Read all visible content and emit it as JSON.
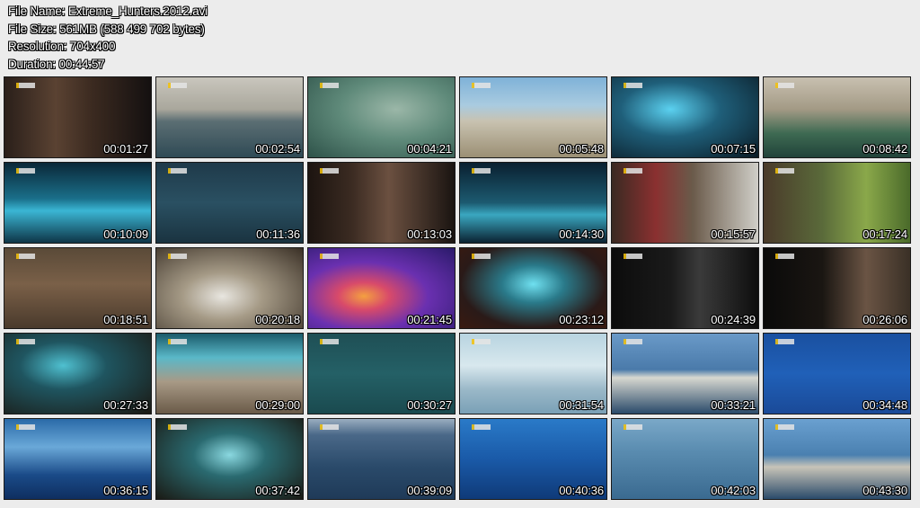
{
  "file_info": {
    "file_name": "File Name: Extreme_Hunters.2012.avi",
    "file_size": "File Size: 561MB (588 499 702 bytes)",
    "resolution": "Resolution: 704x400",
    "duration": "Duration: 00:44:57"
  },
  "thumbnails": [
    {
      "time": "00:01:27",
      "scene": "portrait-man-dark-room",
      "bg": "linear-gradient(90deg,#2a1f1a 0%,#5a4232 35%,#3b2a20 60%,#141010 100%)"
    },
    {
      "time": "00:02:54",
      "scene": "ocean-cloudy-sky",
      "bg": "linear-gradient(180deg,#c9c6bd 0%,#a9a79c 40%,#5b6e73 55%,#2f4a55 100%)"
    },
    {
      "time": "00:04:21",
      "scene": "underwater-green-bubbles",
      "bg": "radial-gradient(ellipse at 60% 40%,#9bb7a8 0%,#5f8a7a 45%,#2e5249 100%)"
    },
    {
      "time": "00:05:48",
      "scene": "tropical-pool-people",
      "bg": "linear-gradient(180deg,#7fb2d8 0%,#a9cbe0 35%,#c8c2b0 55%,#9b8f74 100%)"
    },
    {
      "time": "00:07:15",
      "scene": "hologram-man-blue",
      "bg": "radial-gradient(ellipse at 40% 40%,#5bd1f0 0%,#1f5f7a 40%,#0a1a24 100%)"
    },
    {
      "time": "00:08:42",
      "scene": "man-hat-fishing",
      "bg": "linear-gradient(180deg,#c8c0b0 0%,#a39a85 40%,#3e6a52 70%,#21433a 100%)"
    },
    {
      "time": "00:10:09",
      "scene": "hologram-blue-grid",
      "bg": "linear-gradient(180deg,#0b2838 0%,#1a6f8a 45%,#3bb6d4 60%,#0e3547 100%)"
    },
    {
      "time": "00:11:36",
      "scene": "deep-blue-water",
      "bg": "linear-gradient(180deg,#1f3a4a 0%,#2a5062 50%,#1a3340 100%)"
    },
    {
      "time": "00:13:03",
      "scene": "portrait-man-dark-room",
      "bg": "linear-gradient(90deg,#1c1410 0%,#3b2b22 30%,#6b5040 55%,#1a1411 100%)"
    },
    {
      "time": "00:14:30",
      "scene": "hologram-whale-grid",
      "bg": "linear-gradient(180deg,#0a2030 0%,#1c5a70 50%,#3aa7c0 65%,#0b2231 100%)"
    },
    {
      "time": "00:15:57",
      "scene": "workbench-red-toolbox",
      "bg": "linear-gradient(90deg,#3a2a22 0%,#8a3030 30%,#6a5a4a 55%,#d0cfc8 100%)"
    },
    {
      "time": "00:17:24",
      "scene": "man-forest-green",
      "bg": "linear-gradient(90deg,#4a3a2a 0%,#5a6a3a 40%,#8aa84a 70%,#4a6a2a 100%)"
    },
    {
      "time": "00:18:51",
      "scene": "tree-roots-forest",
      "bg": "linear-gradient(180deg,#5a4a38 0%,#7a6048 45%,#4a3a2c 100%)"
    },
    {
      "time": "00:20:18",
      "scene": "white-mug-closeup",
      "bg": "radial-gradient(ellipse at 45% 60%,#e8e6e0 0%,#a59a86 35%,#3a3026 100%)"
    },
    {
      "time": "00:21:45",
      "scene": "thermal-camera",
      "bg": "radial-gradient(ellipse at 38% 60%,#f4a040 0%,#d84a6a 20%,#6a30b0 50%,#2a1a6a 100%)"
    },
    {
      "time": "00:23:12",
      "scene": "hologram-head-platform",
      "bg": "radial-gradient(ellipse at 50% 45%,#6fe0f0 0%,#2a7a8a 30%,#2a1a18 70%,#3a1a10 100%)"
    },
    {
      "time": "00:24:39",
      "scene": "night-vision-room",
      "bg": "linear-gradient(90deg,#0c0c0c 0%,#1a1a1a 40%,#3a3a3a 60%,#0e0e0e 100%)"
    },
    {
      "time": "00:26:06",
      "scene": "man-closeup-dark",
      "bg": "linear-gradient(90deg,#0a0a0a 0%,#1a1612 40%,#6a5444 70%,#3a3026 100%)"
    },
    {
      "time": "00:27:33",
      "scene": "hologram-stage-people",
      "bg": "radial-gradient(ellipse at 40% 40%,#4fc0d0 0%,#1f5560 35%,#1a1812 100%)"
    },
    {
      "time": "00:29:00",
      "scene": "hologram-room-wide",
      "bg": "linear-gradient(180deg,#1a5a6a 0%,#5ab8c8 30%,#a89a86 60%,#6a5a48 100%)"
    },
    {
      "time": "00:30:27",
      "scene": "underwater-whale-dark",
      "bg": "linear-gradient(180deg,#1f4f55 0%,#246066 50%,#1a4a4f 100%)"
    },
    {
      "time": "00:31:54",
      "scene": "waves-foam-light",
      "bg": "linear-gradient(180deg,#b8d4e0 0%,#d8e8ee 40%,#9ab8c8 70%,#7aa0b6 100%)"
    },
    {
      "time": "00:33:21",
      "scene": "man-boat-jacket",
      "bg": "linear-gradient(180deg,#6a9ac8 0%,#4a7aaa 45%,#d8d8d0 55%,#2a4a6a 100%)"
    },
    {
      "time": "00:34:48",
      "scene": "open-blue-water",
      "bg": "linear-gradient(180deg,#1a50a0 0%,#2060b8 50%,#1a4a98 100%)"
    },
    {
      "time": "00:36:15",
      "scene": "underwater-surface-splash",
      "bg": "linear-gradient(180deg,#2a6aa8 0%,#6aa8d8 35%,#1a4a88 70%,#0f2f60 100%)"
    },
    {
      "time": "00:37:42",
      "scene": "hologram-whale-stage",
      "bg": "radial-gradient(ellipse at 50% 45%,#8ad8e0 0%,#2a6a70 35%,#1a1a14 100%)"
    },
    {
      "time": "00:39:09",
      "scene": "ocean-whale-surface",
      "bg": "linear-gradient(180deg,#9aaec0 0%,#4a6888 20%,#2a4a6a 60%,#1f3a58 100%)"
    },
    {
      "time": "00:40:36",
      "scene": "underwater-sperm-whale",
      "bg": "linear-gradient(180deg,#2a7ac8 0%,#1a5aa8 50%,#0f3a78 100%)"
    },
    {
      "time": "00:42:03",
      "scene": "ocean-surface-light",
      "bg": "linear-gradient(180deg,#7aa8c8 0%,#5a8cb0 40%,#3a6a90 100%)"
    },
    {
      "time": "00:43:30",
      "scene": "man-boat-sunglasses",
      "bg": "linear-gradient(180deg,#6aa0d0 0%,#4a80b0 45%,#c8c4b8 60%,#2a4a6a 100%)"
    }
  ]
}
